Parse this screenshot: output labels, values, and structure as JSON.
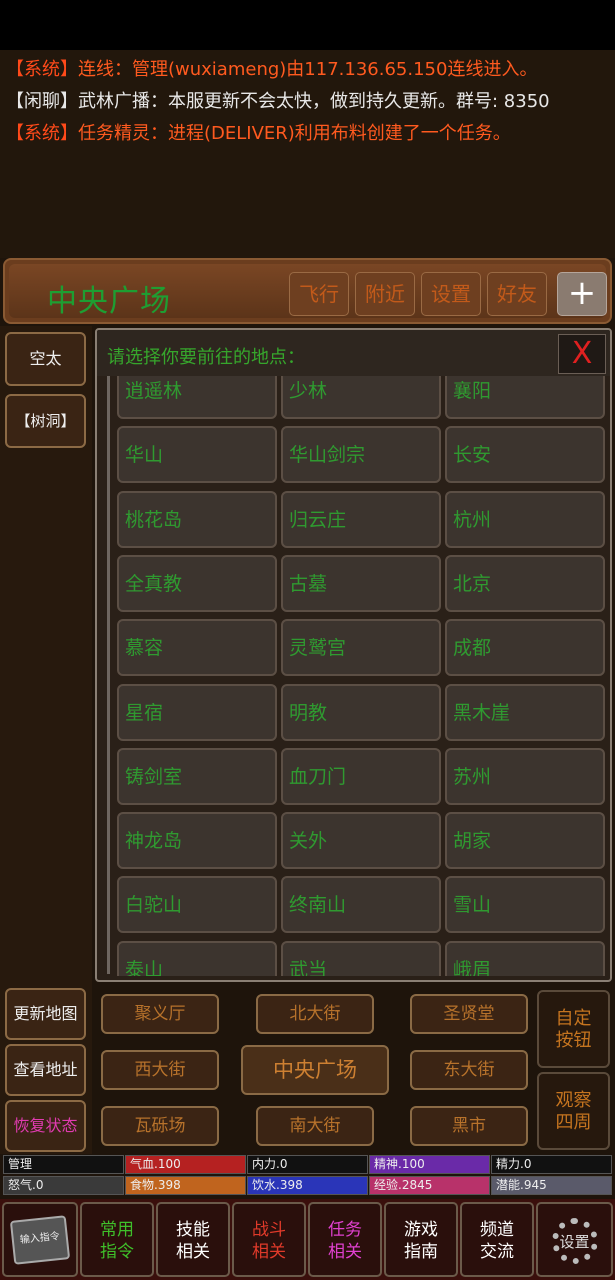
{
  "messages": [
    {
      "type": "sys",
      "tag": "系统",
      "text": "连线：管理(wuxiameng)由117.136.65.150连线进入。"
    },
    {
      "type": "chat",
      "tag": "闲聊",
      "text": "武林广播：本服更新不会太快，做到持久更新。群号: 8350"
    },
    {
      "type": "sys",
      "tag": "系统",
      "text": "任务精灵：进程(DELIVER)利用布料创建了一个任务。"
    }
  ],
  "header": {
    "location": "中央广场",
    "buttons": [
      "飞行",
      "附近",
      "设置",
      "好友"
    ],
    "plus": "+"
  },
  "left_panel": {
    "items": [
      "空太",
      "【树洞】"
    ]
  },
  "dialog": {
    "title": "请选择你要前往的地点：",
    "close": "X",
    "locations": [
      "逍遥林",
      "少林",
      "襄阳",
      "华山",
      "华山剑宗",
      "长安",
      "桃花岛",
      "归云庄",
      "杭州",
      "全真教",
      "古墓",
      "北京",
      "慕容",
      "灵鹫宫",
      "成都",
      "星宿",
      "明教",
      "黑木崖",
      "铸剑室",
      "血刀门",
      "苏州",
      "神龙岛",
      "关外",
      "胡家",
      "白驼山",
      "终南山",
      "雪山",
      "泰山",
      "武当",
      "峨眉"
    ]
  },
  "map_side_buttons": [
    "更新地图",
    "查看地址",
    "恢复状态"
  ],
  "map_nav": {
    "north_west": "聚义厅",
    "north": "北大街",
    "north_east": "圣贤堂",
    "west": "西大街",
    "center": "中央广场",
    "east": "东大街",
    "south_west": "瓦砾场",
    "south": "南大街",
    "south_east": "黑市"
  },
  "right_buttons": [
    {
      "line1": "自定",
      "line2": "按钮"
    },
    {
      "line1": "观察",
      "line2": "四周"
    }
  ],
  "stats": [
    {
      "label": "管理",
      "color": "#111111"
    },
    {
      "label": "气血.100",
      "color": "#b52121"
    },
    {
      "label": "内力.0",
      "color": "#111111"
    },
    {
      "label": "精神.100",
      "color": "#6a2aa8"
    },
    {
      "label": "精力.0",
      "color": "#111111"
    },
    {
      "label": "怒气.0",
      "color": "#3a3a3a"
    },
    {
      "label": "食物.398",
      "color": "#c0641e"
    },
    {
      "label": "饮水.398",
      "color": "#2a35b8"
    },
    {
      "label": "经验.2845",
      "color": "#b8326a"
    },
    {
      "label": "潜能.945",
      "color": "#5a5a6a"
    }
  ],
  "bottom_bar": {
    "input_label": "输入指令",
    "buttons": [
      {
        "line1": "常用",
        "line2": "指令",
        "color": "#3fbf2a"
      },
      {
        "line1": "技能",
        "line2": "相关",
        "color": "#ffffff"
      },
      {
        "line1": "战斗",
        "line2": "相关",
        "color": "#e03a2a"
      },
      {
        "line1": "任务",
        "line2": "相关",
        "color": "#e040d0"
      },
      {
        "line1": "游戏",
        "line2": "指南",
        "color": "#ffffff"
      },
      {
        "line1": "频道",
        "line2": "交流",
        "color": "#ffffff"
      }
    ],
    "settings_label": "设置"
  }
}
